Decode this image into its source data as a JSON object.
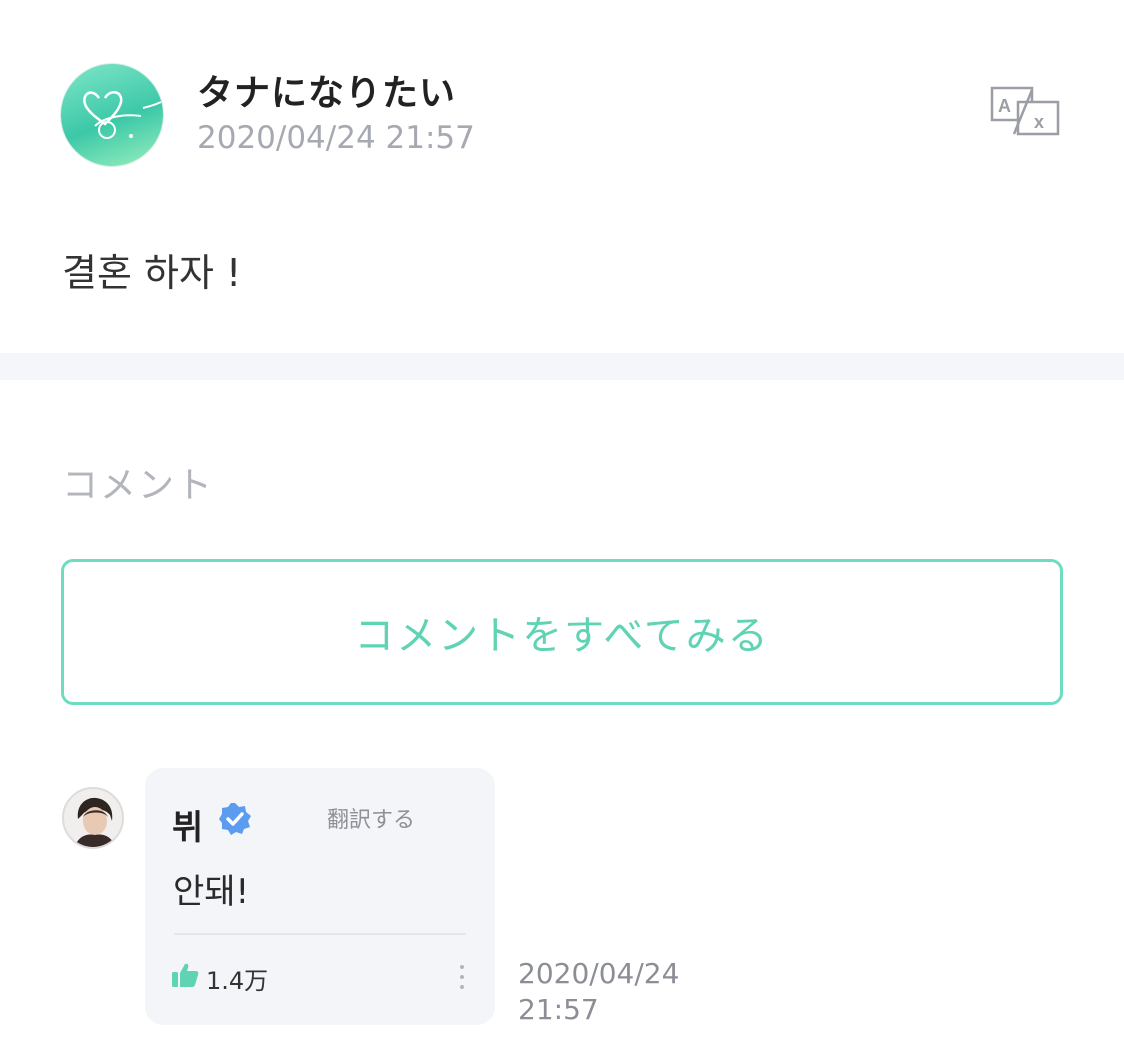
{
  "post": {
    "author": "タナになりたい",
    "timestamp": "2020/04/24 21:57",
    "body": "결혼 하자 !",
    "translate_icon": "translate-icon"
  },
  "comments_section": {
    "label": "コメント",
    "view_all_label": "コメントをすべてみる"
  },
  "comment": {
    "author": "뷔",
    "verified": true,
    "translate_label": "翻訳する",
    "text": "안돼!",
    "likes": "1.4万",
    "date": "2020/04/24",
    "time": "21:57"
  },
  "colors": {
    "accent": "#6edcc0",
    "verified": "#5b9cf0",
    "muted": "#a7a9b2"
  }
}
